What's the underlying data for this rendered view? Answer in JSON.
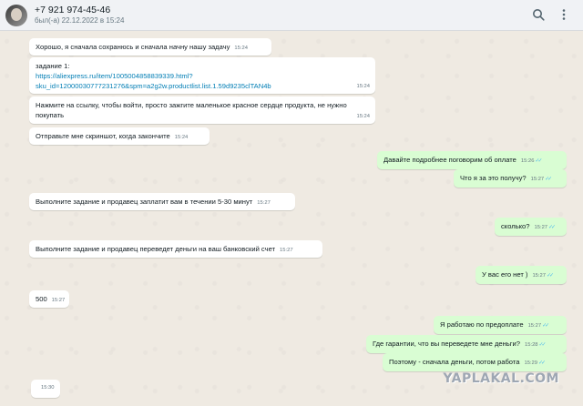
{
  "header": {
    "title": "+7 921 974-45-46",
    "last_seen": "был(-а) 22.12.2022 в 15:24",
    "icons": [
      "search-icon",
      "menu-icon"
    ]
  },
  "messages": [
    {
      "dir": "in",
      "text": "Хорошо, я сначала сохранюсь и сначала начну нашу задачу",
      "time": "15:24"
    },
    {
      "dir": "in",
      "text": "задание 1:",
      "link1": "https://aliexpress.ru/item/1005004858839339.html?",
      "link2": "sku_id=12000030777231276&spm=a2g2w.productlist.list.1.59d9235clTAN4b",
      "time": "15:24"
    },
    {
      "dir": "in",
      "text": "Нажмите на ссылку, чтобы войти, просто зажгите маленькое красное сердце продукта, не нужно покупать",
      "time": "15:24"
    },
    {
      "dir": "in",
      "text": "Отправьте  мне скриншот, когда закончите",
      "time": "15:24"
    },
    {
      "dir": "out",
      "text": "Давайте подробнее поговорим об оплате",
      "time": "15:26"
    },
    {
      "dir": "out",
      "text": "Что я за это получу?",
      "time": "15:27"
    },
    {
      "dir": "in",
      "text": "Выполните задание и продавец заплатит вам в течении 5-30 минут",
      "time": "15:27"
    },
    {
      "dir": "out",
      "text": "сколько?",
      "time": "15:27"
    },
    {
      "dir": "in",
      "text": "Выполните задание и продавец переведет деньги на ваш банковский счет",
      "time": "15:27"
    },
    {
      "dir": "out",
      "text": "У вас его нет )",
      "time": "15:27"
    },
    {
      "dir": "in",
      "text": "500",
      "time": "15:27"
    },
    {
      "dir": "out",
      "text": "Я работаю по предоплате",
      "time": "15:27"
    },
    {
      "dir": "out",
      "text": "Где гарантии, что вы переведете мне деньги?",
      "time": "15:28"
    },
    {
      "dir": "out",
      "text": "Поэтому - сначала деньги, потом работа",
      "time": "15:29"
    },
    {
      "dir": "in",
      "text": "",
      "time": "15:30"
    }
  ],
  "tick_glyph": "✓✓",
  "watermark": "YAPLAKAL.COM",
  "colors": {
    "incoming": "#ffffff",
    "outgoing": "#d9fdd3",
    "background": "#efeae2",
    "ticks": "#53bdeb"
  }
}
